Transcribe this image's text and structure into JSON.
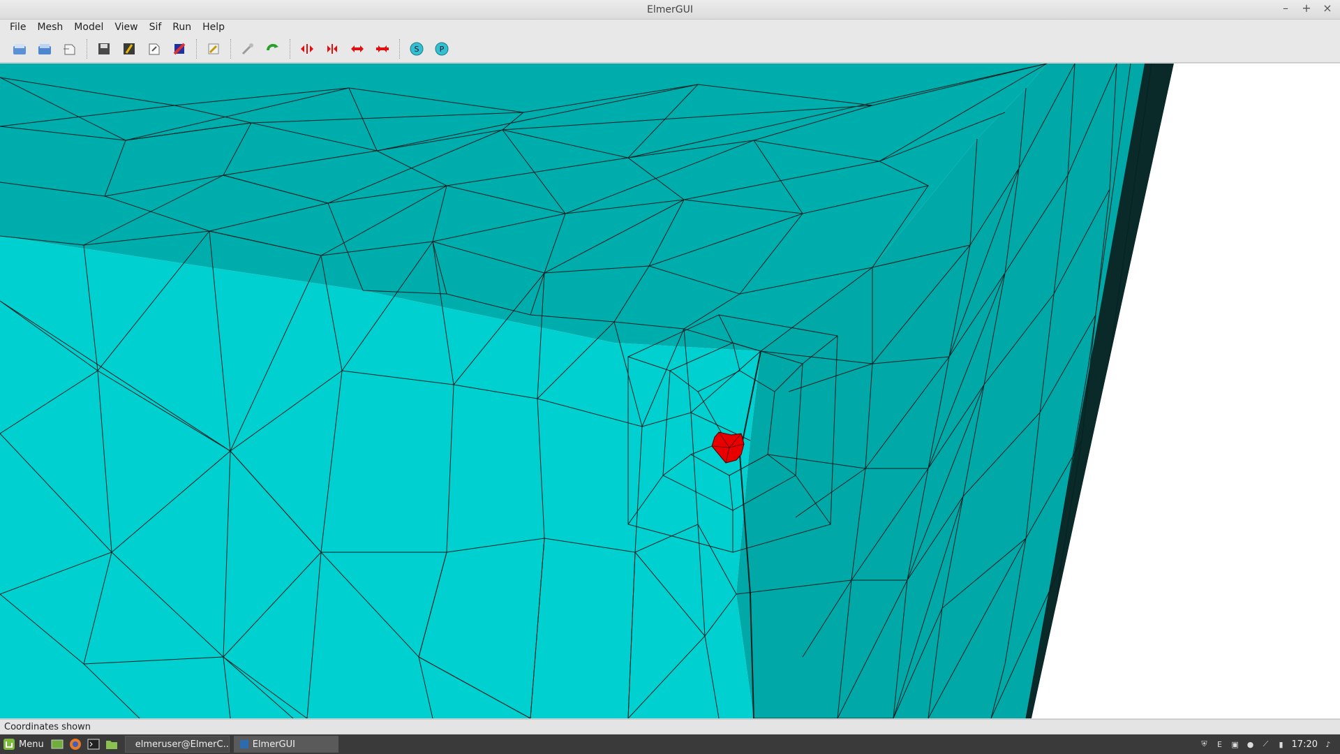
{
  "window": {
    "title": "ElmerGUI"
  },
  "menu": [
    "File",
    "Mesh",
    "Model",
    "View",
    "Sif",
    "Run",
    "Help"
  ],
  "toolbar": {
    "buttons": [
      {
        "icon": "open-icon"
      },
      {
        "icon": "load-icon"
      },
      {
        "icon": "load-project-icon"
      },
      {
        "icon": "save-icon"
      },
      {
        "icon": "save-as-icon"
      },
      {
        "icon": "save-project-icon"
      },
      {
        "icon": "surface-mesh-icon"
      },
      {
        "icon": "edit-definitions-icon"
      },
      {
        "icon": "remesh-icon"
      },
      {
        "icon": "refresh-icon"
      },
      {
        "icon": "divide-surface-icon"
      },
      {
        "icon": "unify-surface-icon"
      },
      {
        "icon": "divide-edge-icon"
      },
      {
        "icon": "unify-edge-icon"
      },
      {
        "icon": "start-solver-icon"
      },
      {
        "icon": "start-paraview-icon"
      }
    ],
    "solver_letter": "S",
    "post_letter": "P"
  },
  "colors": {
    "mesh_fill": "#00cfcf",
    "mesh_top": "#00acac",
    "mesh_side": "#00a8a8",
    "highlight": "#e80000"
  },
  "status": {
    "text": "Coordinates shown"
  },
  "taskbar": {
    "menu_label": "Menu",
    "tasks": [
      "elmeruser@ElmerC...",
      "ElmerGUI"
    ],
    "clock": "17:20"
  }
}
